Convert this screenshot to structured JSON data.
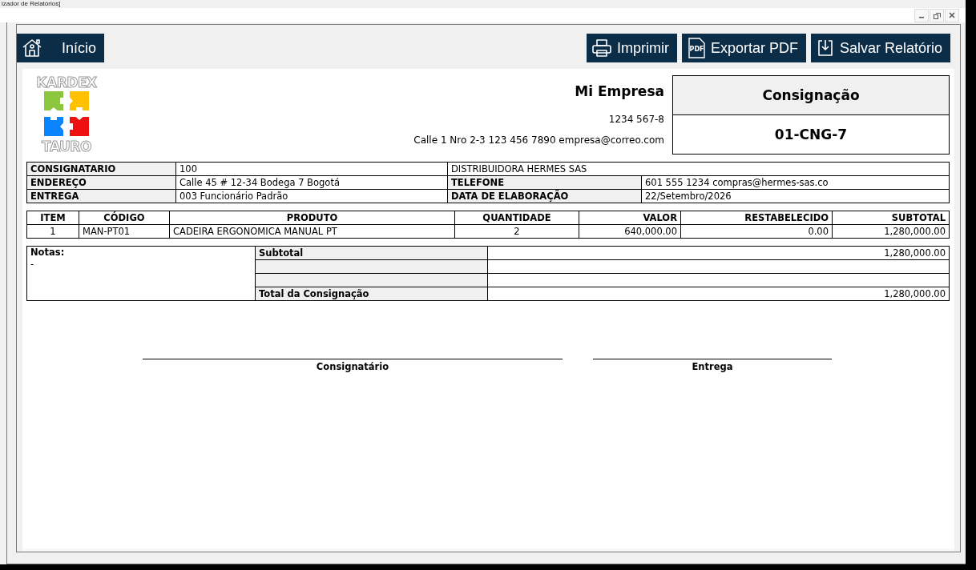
{
  "window": {
    "title": "izador de Relatórios]"
  },
  "toolbar": {
    "home": {
      "label": "Início"
    },
    "actions": [
      {
        "kind": "print",
        "label": "Imprimir"
      },
      {
        "kind": "pdf",
        "label": "Exportar PDF",
        "icon_text": "PDF"
      },
      {
        "kind": "save",
        "label": "Salvar Relatório"
      }
    ]
  },
  "logo": {
    "top": "KARDEX",
    "bottom": "TAURO"
  },
  "company": {
    "name": "Mi Empresa",
    "id": "1234 567-8",
    "contact": "Calle 1 Nro 2-3 123 456 7890 empresa@correo.com"
  },
  "document": {
    "type": "Consignação",
    "number": "01-CNG-7"
  },
  "info_rows": [
    [
      {
        "kind": "label",
        "text": "CONSIGNATARIO"
      },
      {
        "kind": "value",
        "text": "100"
      },
      {
        "kind": "wide",
        "text": "DISTRIBUIDORA HERMES SAS"
      }
    ],
    [
      {
        "kind": "label",
        "text": "ENDEREÇO"
      },
      {
        "kind": "value",
        "text": "Calle 45 # 12-34 Bodega 7 Bogotá"
      },
      {
        "kind": "label",
        "text": "TELEFONE"
      },
      {
        "kind": "value",
        "text": "601 555 1234 compras@hermes-sas.co"
      }
    ],
    [
      {
        "kind": "label",
        "text": "ENTREGA"
      },
      {
        "kind": "value",
        "text": "003 Funcionário Padrão"
      },
      {
        "kind": "label",
        "text": "DATA DE ELABORAÇÃO"
      },
      {
        "kind": "value",
        "text": "22/Setembro/2026"
      }
    ]
  ],
  "items": {
    "columns": [
      {
        "label": "ITEM"
      },
      {
        "label": "CÓDIGO"
      },
      {
        "label": "PRODUTO"
      },
      {
        "label": "QUANTIDADE"
      },
      {
        "label": "VALOR"
      },
      {
        "label": "RESTABELECIDO"
      },
      {
        "label": "SUBTOTAL"
      }
    ],
    "rows": [
      {
        "cells": [
          "1",
          "MAN-PT01",
          "CADEIRA ERGONOMICA MANUAL PT",
          "2",
          "640,000.00",
          "0.00",
          "1,280,000.00"
        ]
      }
    ]
  },
  "notes": {
    "label": "Notas:",
    "text": "-"
  },
  "totals": [
    {
      "kind": "line",
      "label": "Subtotal",
      "value": "1,280,000.00"
    },
    {
      "kind": "blank"
    },
    {
      "kind": "blank"
    },
    {
      "kind": "line",
      "label": "Total da Consignação",
      "value": "1,280,000.00"
    }
  ],
  "signatures": [
    {
      "label": "Consignatário"
    },
    {
      "label": "Entrega"
    }
  ]
}
